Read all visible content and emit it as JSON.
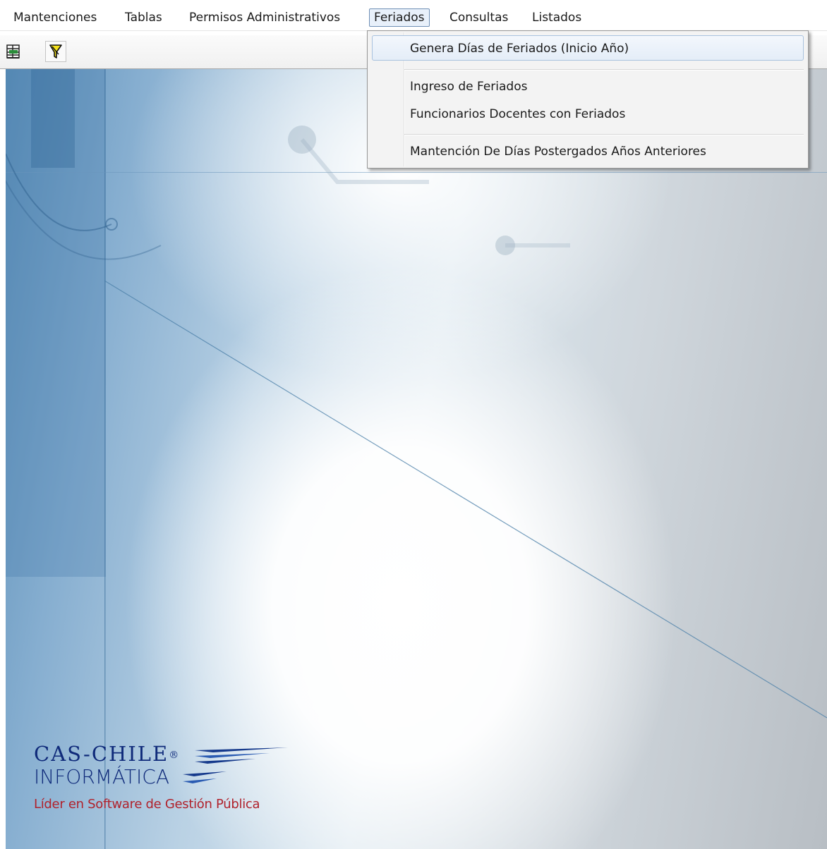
{
  "menubar": {
    "items": [
      {
        "label": "Mantenciones"
      },
      {
        "label": "Tablas"
      },
      {
        "label": "Permisos Administrativos"
      },
      {
        "label": "Feriados"
      },
      {
        "label": "Consultas"
      },
      {
        "label": "Listados"
      }
    ],
    "active": "Feriados"
  },
  "toolbar": {
    "buttons": [
      {
        "icon": "grid-exit-icon"
      },
      {
        "icon": "filter-icon"
      }
    ]
  },
  "dropdown": {
    "items": [
      {
        "label": "Genera Días de Feriados  (Inicio Año)",
        "highlighted": true
      },
      {
        "label": "Ingreso de Feriados"
      },
      {
        "label": "Funcionarios Docentes con Feriados"
      },
      {
        "label": "Mantención De Días Postergados Años Anteriores"
      }
    ]
  },
  "logo": {
    "brand_line1": "CAS-CHILE",
    "registered": "®",
    "brand_line2": "INFORMÁTICA",
    "tagline": "Líder en Software de Gestión Pública",
    "colors": {
      "brand": "#0f2a7a",
      "tagline": "#b0222c"
    }
  }
}
